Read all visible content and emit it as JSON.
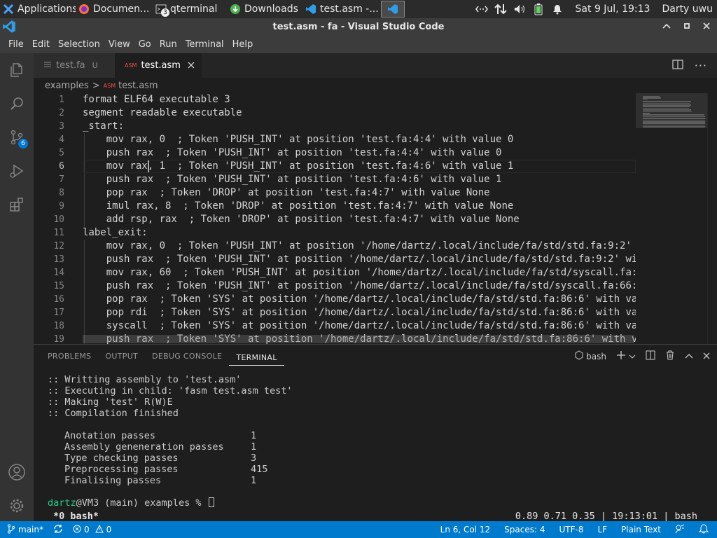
{
  "taskbar": {
    "items": [
      {
        "label": "Applications",
        "icon": "xfce-mouse-icon"
      },
      {
        "label": "Documen...",
        "icon": "firefox-icon"
      },
      {
        "label": "qterminal",
        "icon": "terminal-icon",
        "badge": "3"
      },
      {
        "label": "Downloads",
        "icon": "downloads-icon"
      },
      {
        "label": "test.asm -...",
        "icon": "vscode-icon"
      }
    ],
    "clock": "Sat  9 Jul, 19:13",
    "user": "Darty uwu",
    "tray_icons": [
      "network-icon",
      "transfer-arrows-icon",
      "volume-icon",
      "battery-icon",
      "notification-bell-icon"
    ]
  },
  "window": {
    "title": "test.asm - fa - Visual Studio Code"
  },
  "menu": [
    "File",
    "Edit",
    "Selection",
    "View",
    "Go",
    "Run",
    "Terminal",
    "Help"
  ],
  "activity_bar": {
    "items": [
      "explorer-icon",
      "search-icon",
      "source-control-icon",
      "run-debug-icon",
      "extensions-icon"
    ],
    "scm_badge": "6",
    "bottom": [
      "account-icon",
      "manage-gear-icon"
    ]
  },
  "tabs": [
    {
      "label": "test.fa",
      "status": "U",
      "active": false
    },
    {
      "label": "test.asm",
      "icon_text": "ASM",
      "active": true
    }
  ],
  "breadcrumb": {
    "folder": "examples",
    "separator": ">",
    "file_icon_text": "ASM",
    "file": "test.asm"
  },
  "editor": {
    "cursor_line": 6,
    "lines": [
      {
        "n": "1",
        "text": "format ELF64 executable 3"
      },
      {
        "n": "2",
        "text": "segment readable executable"
      },
      {
        "n": "3",
        "text": "_start:"
      },
      {
        "n": "4",
        "text": "    mov rax, 0  ; Token 'PUSH_INT' at position 'test.fa:4:4' with value 0"
      },
      {
        "n": "5",
        "text": "    push rax  ; Token 'PUSH_INT' at position 'test.fa:4:4' with value 0"
      },
      {
        "n": "6",
        "text": "    mov rax, 1  ; Token 'PUSH_INT' at position 'test.fa:4:6' with value 1"
      },
      {
        "n": "7",
        "text": "    push rax  ; Token 'PUSH_INT' at position 'test.fa:4:6' with value 1"
      },
      {
        "n": "8",
        "text": "    pop rax  ; Token 'DROP' at position 'test.fa:4:7' with value None"
      },
      {
        "n": "9",
        "text": "    imul rax, 8  ; Token 'DROP' at position 'test.fa:4:7' with value None"
      },
      {
        "n": "10",
        "text": "    add rsp, rax  ; Token 'DROP' at position 'test.fa:4:7' with value None"
      },
      {
        "n": "11",
        "text": "label_exit:"
      },
      {
        "n": "12",
        "text": "    mov rax, 0  ; Token 'PUSH_INT' at position '/home/dartz/.local/include/fa/std/std.fa:9:2'"
      },
      {
        "n": "13",
        "text": "    push rax  ; Token 'PUSH_INT' at position '/home/dartz/.local/include/fa/std/std.fa:9:2' wi"
      },
      {
        "n": "14",
        "text": "    mov rax, 60  ; Token 'PUSH_INT' at position '/home/dartz/.local/include/fa/std/syscall.fa:"
      },
      {
        "n": "15",
        "text": "    push rax  ; Token 'PUSH_INT' at position '/home/dartz/.local/include/fa/std/syscall.fa:66:"
      },
      {
        "n": "16",
        "text": "    pop rax  ; Token 'SYS' at position '/home/dartz/.local/include/fa/std/std.fa:86:6' with va"
      },
      {
        "n": "17",
        "text": "    pop rdi  ; Token 'SYS' at position '/home/dartz/.local/include/fa/std/std.fa:86:6' with va"
      },
      {
        "n": "18",
        "text": "    syscall  ; Token 'SYS' at position '/home/dartz/.local/include/fa/std/std.fa:86:6' with va"
      },
      {
        "n": "19",
        "text": "    push rax  ; Token 'SYS' at position '/home/dartz/.local/include/fa/std/std.fa:86:6' with v"
      }
    ]
  },
  "panel": {
    "tabs": [
      "PROBLEMS",
      "OUTPUT",
      "DEBUG CONSOLE",
      "TERMINAL"
    ],
    "active_tab": "TERMINAL",
    "shell": "bash",
    "actions": [
      "new-terminal-plus-icon",
      "dropdown-chevron-icon",
      "split-terminal-icon",
      "trash-icon",
      "maximize-chevron-icon",
      "close-icon"
    ],
    "terminal": {
      "messages": [
        ":: Writting assembly to 'test.asm'",
        ":: Executing in child: 'fasm test.asm test'",
        ":: Making 'test' R(W)E",
        ":: Compilation finished"
      ],
      "stats": [
        {
          "label": "Anotation passes",
          "value": "1"
        },
        {
          "label": "Assembly geneneration passes",
          "value": "1"
        },
        {
          "label": "Type checking passes",
          "value": "3"
        },
        {
          "label": "Preprocessing passes",
          "value": "415"
        },
        {
          "label": "Finalising passes",
          "value": "1"
        }
      ],
      "prompt_user": "dartz",
      "prompt_rest": "@VM3 (main) examples % ",
      "tmux_left": "*0 bash*",
      "tmux_right": "0.89 0.71 0.35 | 19:13:01 | bash"
    }
  },
  "status_bar": {
    "branch": "main*",
    "errors": "0",
    "warnings": "0",
    "position": "Ln 6, Col 12",
    "spaces": "Spaces: 4",
    "encoding": "UTF-8",
    "eol": "LF",
    "language": "Plain Text"
  },
  "colors": {
    "accent": "#007acc",
    "editor_bg": "#1e1e1e",
    "terminal_user": "#23d18b"
  }
}
